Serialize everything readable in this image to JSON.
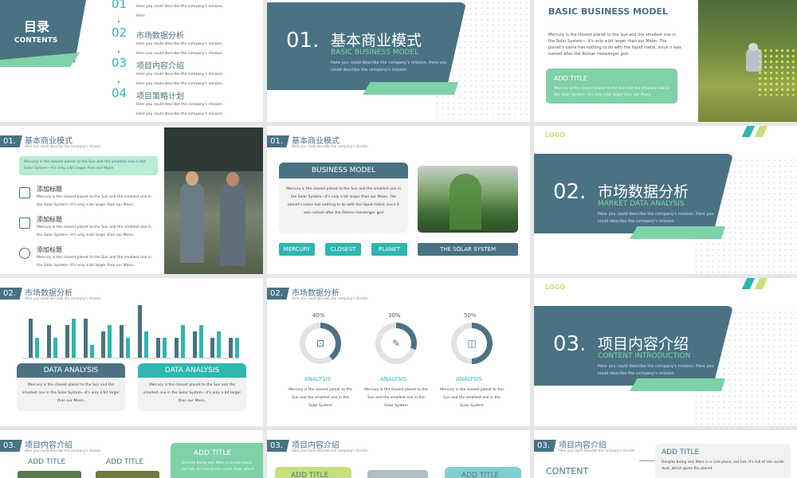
{
  "colors": {
    "primary": "#4a7283",
    "mint": "#7fd1a6",
    "teal": "#2fb6b0",
    "light_mint": "#cdeedd"
  },
  "s1": {
    "title": "目录",
    "subtitle": "CONTENTS",
    "items": [
      {
        "num": "01",
        "label": "",
        "desc": "Here you could describe the company's mission. Here"
      },
      {
        "num": "02",
        "label": "市场数据分析",
        "desc": "Here you could describe the company's mission. Here you could describe the company's mission."
      },
      {
        "num": "03",
        "label": "项目内容介绍",
        "desc": "Here you could describe the company's mission. Here you could describe the company's mission."
      },
      {
        "num": "04",
        "label": "项目策略计划",
        "desc": "Here you could describe the company's mission. Here you could describe the company's mission."
      }
    ]
  },
  "s2": {
    "num": "01.",
    "title": "基本商业模式",
    "en": "BASIC BUSINESS MODEL",
    "desc": "Here you could describe the company's mission. Here you could describe the company's mission."
  },
  "s3": {
    "title": "BASIC BUSINESS MODEL",
    "text": "Mercury is the closest planet to the Sun and the smallest one in the Solar System— it's only a bit larger than our Moon. The planet's name has nothing to do with the liquid metal, since it was named after the Roman messenger god",
    "box_title": "ADD TITLE",
    "box_text": "Mercury is the closest planet to the Sun and the smallest one in the Solar System—it's only a bit larger than our Moon."
  },
  "s4": {
    "num": "01.",
    "title": "基本商业模式",
    "sub": "Here you could describe the company's mission",
    "box_text": "Mercury is the closest planet to the Sun and the smallest one in the Solar System—It's only a bit larger than our Moon.",
    "items": [
      {
        "title": "添加标题",
        "text": "Mercury is the closest planet to the Sun and the smallest one in the Solar System—It's only a bit larger than our Moon.",
        "icon": "image-icon"
      },
      {
        "title": "添加标题",
        "text": "Mercury is the closest planet to the Sun and the smallest one in the Solar System—It's only a bit larger than our Moon.",
        "icon": "binoculars-icon"
      },
      {
        "title": "添加标题",
        "text": "Mercury is the closest planet to the Sun and the smallest one in the Solar System—It's only a bit larger than our Moon.",
        "icon": "mic-icon"
      }
    ]
  },
  "s5": {
    "num": "01.",
    "title": "基本商业模式",
    "sub": "Here you could describe the company's mission",
    "card_title": "BUSINESS MODEL",
    "card_text": "Mercury is the closest planet to the Sun and the smallest one in the Solar System—it's only a bit larger than our Moon. The planet's name has nothing to do with the liquid metal, since it was named after the Roman messenger god",
    "pills": [
      "MERCURY",
      "CLOSEST",
      "PLANET"
    ],
    "wide_pill": "THE SOLAR SYSTEM"
  },
  "s6": {
    "logo": "LOGO",
    "num": "02.",
    "title": "市场数据分析",
    "en": "MARKET DATA ANALYSIS",
    "desc": "Here you could describe the company's mission. Here you could describe the company's mission."
  },
  "s7": {
    "num": "02.",
    "title": "市场数据分析",
    "sub": "Here you could describe the company's mission",
    "cards": [
      {
        "title": "DATA ANALYSIS",
        "text": "Mercury is the closest planet to the Sun and the smallest one in the Solar System—it's only a bit larger than our Moon."
      },
      {
        "title": "DATA ANALYSIS",
        "text": "Mercury is the closest planet to the Sun and the smallest one in the Solar System—it's only a bit larger than our Moon."
      }
    ]
  },
  "s8": {
    "num": "02.",
    "title": "市场数据分析",
    "sub": "Here you could describe the company's mission",
    "rings": [
      {
        "pct": "40%",
        "value": 0.4,
        "label": "ANALYSIS",
        "icon": "gift-icon",
        "text": "Mercury is the closest planet to the Sun and the smallest one in the Solar System"
      },
      {
        "pct": "30%",
        "value": 0.3,
        "label": "ANALYSIS",
        "icon": "note-icon",
        "text": "Mercury is the closest planet to the Sun and the smallest one in the Solar System"
      },
      {
        "pct": "50%",
        "value": 0.5,
        "label": "ANALYSIS",
        "icon": "layout-icon",
        "text": "Mercury is the closest planet to the Sun and the smallest one in the Solar System"
      }
    ]
  },
  "s9": {
    "logo": "LOGO",
    "num": "03.",
    "title": "项目内容介绍",
    "en": "CONTENT INTRODUCTION",
    "desc": "Here you could describe the company's mission. Here you could describe the company's mission."
  },
  "s10": {
    "num": "03.",
    "title": "项目内容介绍",
    "sub": "Here you could describe the company's mission",
    "t1": "ADD TITLE",
    "t2": "ADD TITLE",
    "box_title": "ADD TITLE",
    "box_text": "Despite being red, Mars is a cold place, not hot. It's full of iron oxide dust, which"
  },
  "s11": {
    "num": "03.",
    "title": "项目内容介绍",
    "sub": "Here you could describe the company's mission",
    "t1": "ADD TITLE",
    "t2": "ADD TITLE"
  },
  "s12": {
    "num": "03.",
    "title": "项目内容介绍",
    "sub": "Here you could describe the company's mission",
    "content": "CONTENT",
    "box_title": "ADD TITLE",
    "box_text": "Despite being red, Mars is a cold place, not hot. It's full of iron oxide dust, which gives the planet"
  },
  "chart_data": {
    "type": "bar",
    "categories": [
      "",
      "",
      "",
      "",
      "",
      "",
      "",
      "",
      "",
      "",
      "",
      ""
    ],
    "series": [
      {
        "values": [
          6,
          5,
          5,
          6,
          4,
          5,
          8,
          3,
          3,
          4,
          3,
          3
        ]
      },
      {
        "values": [
          3,
          3,
          6,
          2,
          5,
          3,
          4,
          3,
          5,
          5,
          4,
          3
        ]
      }
    ],
    "ylim": [
      0,
      8
    ]
  }
}
